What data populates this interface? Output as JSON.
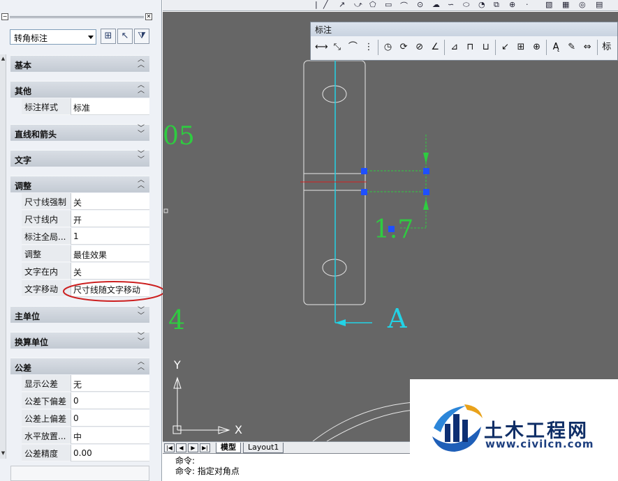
{
  "palette": {
    "object_type": "转角标注",
    "categories": {
      "basic": "基本",
      "other": "其他",
      "lines_arrows": "直线和箭头",
      "text": "文字",
      "fit": "调整",
      "primary_units": "主单位",
      "alt_units": "换算单位",
      "tolerances": "公差"
    },
    "other_props": [
      {
        "name": "标注样式",
        "value": "标准"
      }
    ],
    "fit_props": [
      {
        "name": "尺寸线强制",
        "value": "关"
      },
      {
        "name": "尺寸线内",
        "value": "开"
      },
      {
        "name": "标注全局...",
        "value": "1"
      },
      {
        "name": "调整",
        "value": "最佳效果"
      },
      {
        "name": "文字在内",
        "value": "关"
      },
      {
        "name": "文字移动",
        "value": "尺寸线随文字移动"
      }
    ],
    "tolerance_props": [
      {
        "name": "显示公差",
        "value": "无"
      },
      {
        "name": "公差下偏差",
        "value": "0"
      },
      {
        "name": "公差上偏差",
        "value": "0"
      },
      {
        "name": "水平放置...",
        "value": "中"
      },
      {
        "name": "公差精度",
        "value": "0.00"
      }
    ]
  },
  "dim_toolbar": {
    "title": "标注",
    "last_visible": "标"
  },
  "drawing": {
    "text_05": "05",
    "text_4": "4",
    "dim_value": "1.7",
    "section_label": "A",
    "ucs_y": "Y",
    "ucs_x": "X"
  },
  "tabs": {
    "model": "模型",
    "layout1": "Layout1"
  },
  "command_line": {
    "line1": "命令:",
    "line2": "命令: 指定对角点"
  },
  "watermark": {
    "title": "土木工程网",
    "url": "www.civilcn.com"
  },
  "colors": {
    "canvas_bg": "#666666",
    "dim_green": "#2ecc40",
    "centerline_cyan": "#22d3e6",
    "grip_blue": "#1f4fff",
    "highlight_ellipse": "#cc1f1f"
  }
}
